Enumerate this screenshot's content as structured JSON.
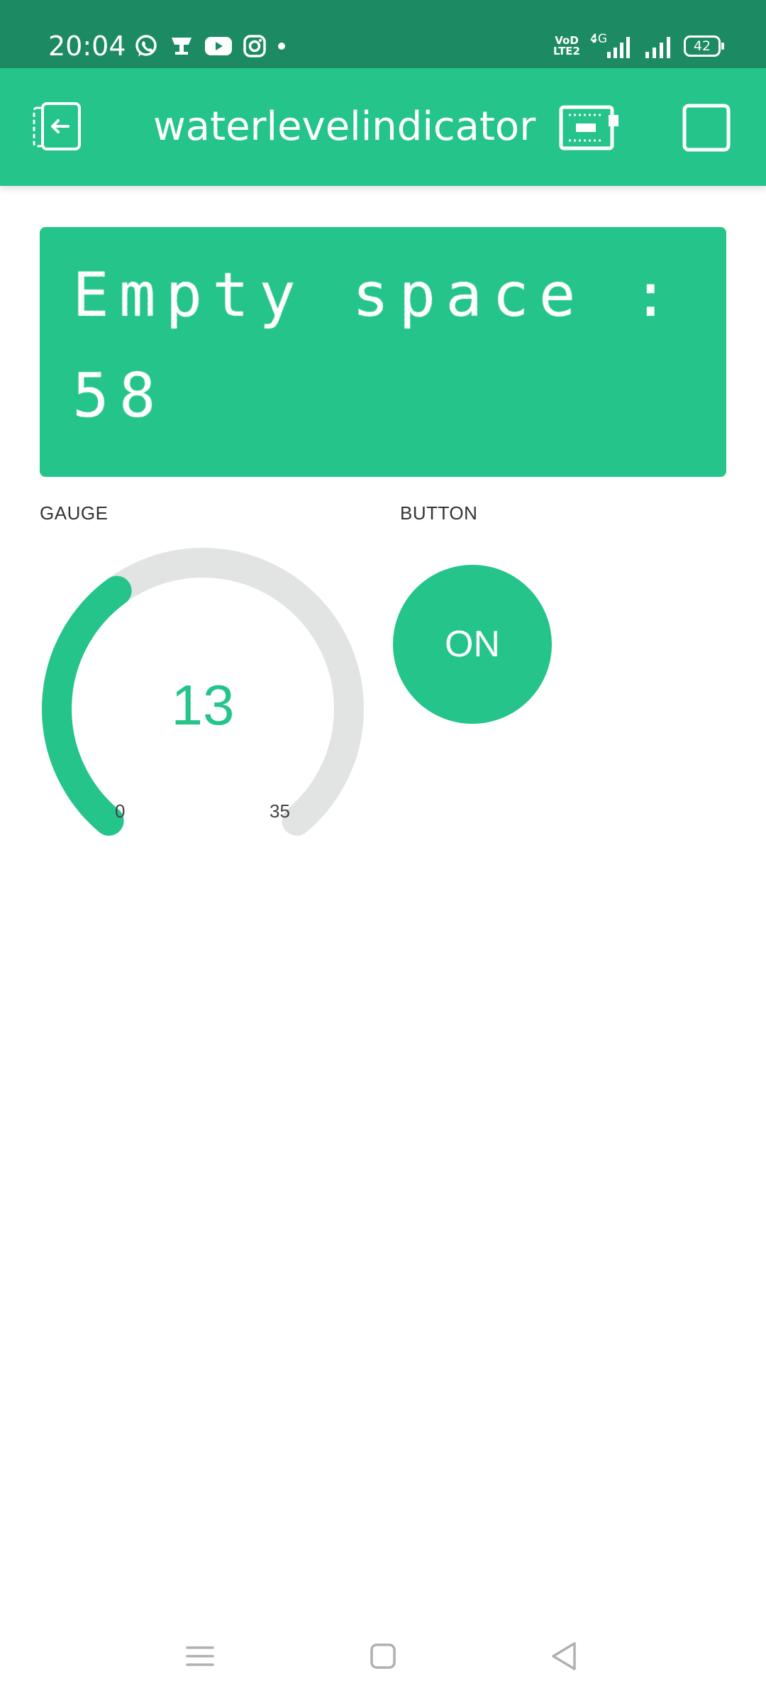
{
  "status_bar": {
    "time": "20:04",
    "left_icons": [
      "whatsapp-icon",
      "notification-icon",
      "youtube-icon",
      "instagram-icon",
      "dot-icon"
    ],
    "volte_top": "VoD",
    "volte_bottom": "LTE2",
    "network": "4G",
    "battery": "42"
  },
  "app_bar": {
    "title": "waterlevelindicator",
    "left_icon": "exit-icon",
    "right_icons": [
      "device-icon",
      "stop-icon"
    ]
  },
  "terminal": {
    "line1": "Empty space :",
    "line2": "58"
  },
  "gauge": {
    "label": "GAUGE",
    "value": "13",
    "min": "0",
    "max": "35",
    "fraction": 0.371,
    "color": "#24c48a",
    "track_color": "#e2e3e3"
  },
  "button": {
    "label": "BUTTON",
    "state_text": "ON"
  },
  "nav": {
    "icons": [
      "menu-icon",
      "home-icon",
      "back-icon"
    ]
  },
  "colors": {
    "accent": "#24c48a",
    "status_bar": "#1c8a63"
  }
}
